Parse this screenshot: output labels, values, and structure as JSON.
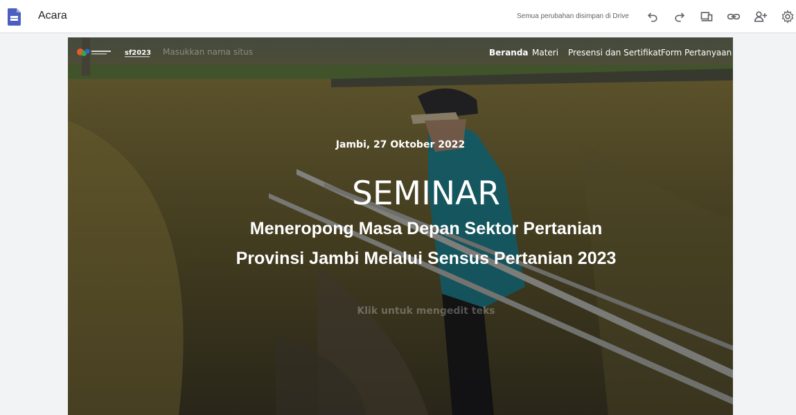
{
  "app": {
    "title": "Acara",
    "save_status": "Semua perubahan disimpan di Drive",
    "toolbar": {
      "undo": "undo-icon",
      "redo": "redo-icon",
      "preview": "preview-devices-icon",
      "link": "link-icon",
      "share": "add-person-icon",
      "settings": "gear-icon"
    }
  },
  "site": {
    "logo_text": "sf2023",
    "name_placeholder": "Masukkan nama situs",
    "nav": [
      {
        "label": "Beranda",
        "active": true
      },
      {
        "label": "Materi",
        "active": false
      },
      {
        "label": "Presensi dan Sertifikat",
        "active": false
      },
      {
        "label": "Form Pertanyaan",
        "active": false
      }
    ]
  },
  "hero": {
    "date": "Jambi, 27 Oktober 2022",
    "title": "SEMINAR",
    "subtitle_line1": "Meneropong Masa Depan Sektor Pertanian",
    "subtitle_line2": "Provinsi Jambi Melalui Sensus Pertanian 2023",
    "hint": "Klik untuk mengedit teks"
  },
  "colors": {
    "accent": "#4c6ef5",
    "doc_icon": "#4b5fc0",
    "toolbar_icon": "#5f6368"
  }
}
